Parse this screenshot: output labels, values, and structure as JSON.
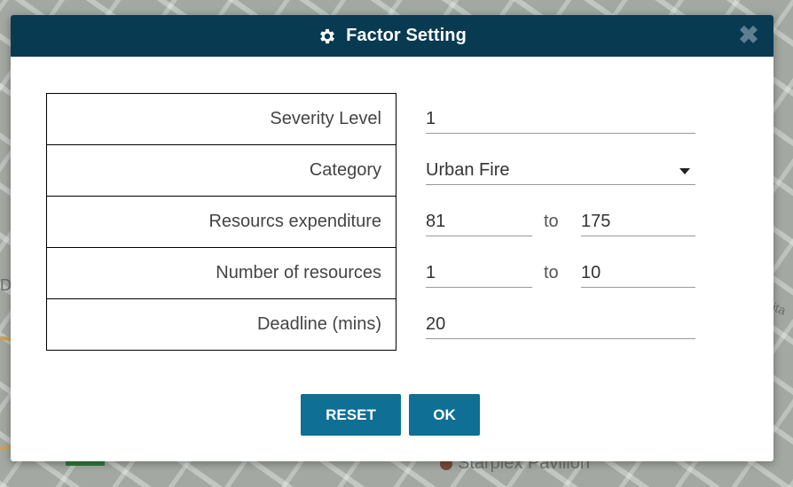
{
  "dialog": {
    "title": "Factor Setting",
    "close_glyph": "✖",
    "title_icon": "gear-icon"
  },
  "form": {
    "rows": [
      {
        "label": "Severity Level",
        "value": "1"
      },
      {
        "label": "Category",
        "value": "Urban Fire"
      },
      {
        "label": "Resourcs expenditure",
        "min": "81",
        "to": "to",
        "max": "175"
      },
      {
        "label": "Number of resources",
        "min": "1",
        "to": "to",
        "max": "10"
      },
      {
        "label": "Deadline (mins)",
        "value": "20"
      }
    ]
  },
  "buttons": {
    "reset": "RESET",
    "ok": "OK"
  },
  "map": {
    "poi_label": "Starplex Pavilion",
    "left_label": "D",
    "right_label": "lita"
  },
  "colors": {
    "titlebar": "#083a52",
    "button": "#0f6f95"
  }
}
